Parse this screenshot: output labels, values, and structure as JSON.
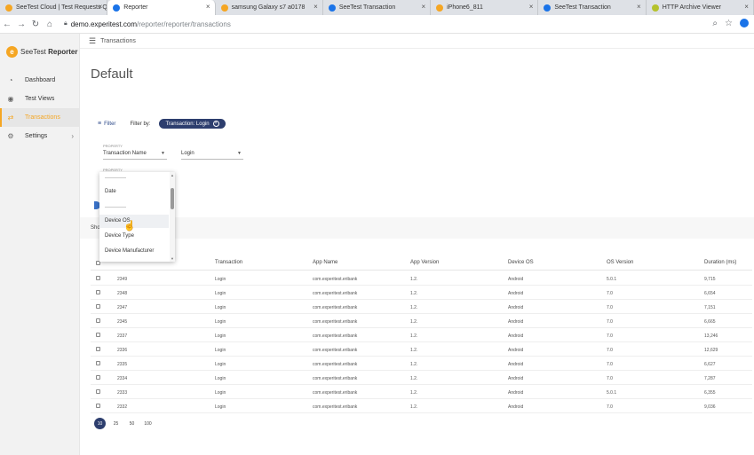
{
  "browser": {
    "tabs": [
      {
        "title": "SeeTest Cloud | Test Requests Q",
        "color": "#f5a623",
        "active": false
      },
      {
        "title": "Reporter",
        "color": "#1a73e8",
        "active": true
      },
      {
        "title": "samsung Galaxy s7 a0178",
        "color": "#f5a623",
        "active": false
      },
      {
        "title": "SeeTest Transaction",
        "color": "#1a73e8",
        "active": false
      },
      {
        "title": "iPhone6_811",
        "color": "#f5a623",
        "active": false
      },
      {
        "title": "SeeTest Transaction",
        "color": "#1a73e8",
        "active": false
      },
      {
        "title": "HTTP Archive Viewer",
        "color": "#b5c22c",
        "active": false
      }
    ],
    "url_host": "demo.experitest.com",
    "url_path": "/reporter/reporter/transactions"
  },
  "sidebar": {
    "logo_prefix": "SeeTest",
    "logo_bold": "Reporter",
    "items": [
      {
        "label": "Dashboard",
        "icon": "dashboard-icon",
        "glyph": "◔",
        "active": false
      },
      {
        "label": "Test Views",
        "icon": "eye-icon",
        "glyph": "◉",
        "active": false
      },
      {
        "label": "Transactions",
        "icon": "transactions-icon",
        "glyph": "⇄",
        "active": true
      },
      {
        "label": "Settings",
        "icon": "gear-icon",
        "glyph": "⚙",
        "active": false
      }
    ]
  },
  "topbar": {
    "breadcrumb": "Transactions"
  },
  "page": {
    "title": "Default"
  },
  "filter": {
    "button_label": "Filter",
    "filter_by_label": "Filter by:",
    "chip_label": "Transaction: Login",
    "property_label": "PROPERTY",
    "property_value": "Transaction Name",
    "value_value": "Login",
    "property2_label": "PROPERTY",
    "show_text": "Sho"
  },
  "dropdown": {
    "items": [
      "Date",
      "Device OS",
      "Device Type",
      "Device Manufacturer"
    ]
  },
  "table": {
    "columns": [
      "Transaction",
      "App Name",
      "App Version",
      "Device OS",
      "OS Version",
      "Duration (ms)"
    ],
    "rows": [
      [
        "2349",
        "Login",
        "com.experitest.eribank",
        "1.2.",
        "Android",
        "5.0.1",
        "9,715"
      ],
      [
        "2348",
        "Login",
        "com.experitest.eribank",
        "1.2.",
        "Android",
        "7.0",
        "6,654"
      ],
      [
        "2347",
        "Login",
        "com.experitest.eribank",
        "1.2.",
        "Android",
        "7.0",
        "7,151"
      ],
      [
        "2345",
        "Login",
        "com.experitest.eribank",
        "1.2.",
        "Android",
        "7.0",
        "6,665"
      ],
      [
        "2337",
        "Login",
        "com.experitest.eribank",
        "1.2.",
        "Android",
        "7.0",
        "13,246"
      ],
      [
        "2336",
        "Login",
        "com.experitest.eribank",
        "1.2.",
        "Android",
        "7.0",
        "12,629"
      ],
      [
        "2335",
        "Login",
        "com.experitest.eribank",
        "1.2.",
        "Android",
        "7.0",
        "6,627"
      ],
      [
        "2334",
        "Login",
        "com.experitest.eribank",
        "1.2.",
        "Android",
        "7.0",
        "7,287"
      ],
      [
        "2333",
        "Login",
        "com.experitest.eribank",
        "1.2.",
        "Android",
        "5.0.1",
        "6,355"
      ],
      [
        "2332",
        "Login",
        "com.experitest.eribank",
        "1.2.",
        "Android",
        "7.0",
        "9,036"
      ]
    ]
  },
  "pager": {
    "sizes": [
      "10",
      "25",
      "50",
      "100"
    ],
    "active": "10"
  }
}
